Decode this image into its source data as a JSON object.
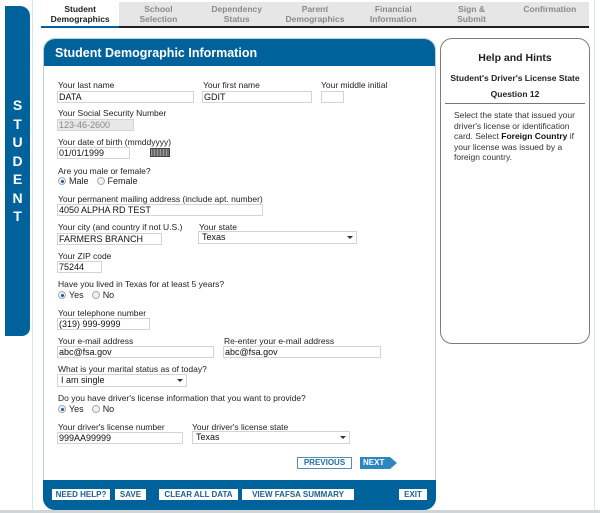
{
  "side_label": "STUDENT",
  "tabs": [
    {
      "line1": "Student",
      "line2": "Demographics",
      "active": true
    },
    {
      "line1": "School",
      "line2": "Selection",
      "active": false
    },
    {
      "line1": "Dependency",
      "line2": "Status",
      "active": false
    },
    {
      "line1": "Parent",
      "line2": "Demographics",
      "active": false
    },
    {
      "line1": "Financial",
      "line2": "Information",
      "active": false
    },
    {
      "line1": "Sign &",
      "line2": "Submit",
      "active": false
    },
    {
      "line1": "Confirmation",
      "line2": "",
      "active": false
    }
  ],
  "form": {
    "title": "Student Demographic Information",
    "last_name": {
      "label": "Your last name",
      "value": "DATA"
    },
    "first_name": {
      "label": "Your first name",
      "value": "GDIT"
    },
    "middle_initial": {
      "label": "Your middle initial",
      "value": ""
    },
    "ssn": {
      "label": "Your Social Security Number",
      "value": "123-46-2600"
    },
    "dob": {
      "label": "Your date of birth (mmddyyyy)",
      "value": "01/01/1999"
    },
    "gender": {
      "label": "Are you male or female?",
      "options": [
        "Male",
        "Female"
      ],
      "selected": "Male"
    },
    "address": {
      "label": "Your permanent mailing address (include apt. number)",
      "value": "4050 ALPHA RD TEST"
    },
    "city": {
      "label": "Your city (and country if not U.S.)",
      "value": "FARMERS BRANCH"
    },
    "state": {
      "label": "Your state",
      "value": "Texas"
    },
    "zip": {
      "label": "Your ZIP code",
      "value": "75244"
    },
    "texas_5yrs": {
      "label": "Have you lived in Texas for at least 5 years?",
      "options": [
        "Yes",
        "No"
      ],
      "selected": "Yes"
    },
    "phone": {
      "label": "Your telephone number",
      "value": "(319) 999-9999"
    },
    "email": {
      "label": "Your e-mail address",
      "value": "abc@fsa.gov"
    },
    "email_confirm": {
      "label": "Re-enter your e-mail address",
      "value": "abc@fsa.gov"
    },
    "marital": {
      "label": "What is your marital status as of today?",
      "value": "I am single"
    },
    "has_license": {
      "label": "Do you have driver's license information that you want to provide?",
      "options": [
        "Yes",
        "No"
      ],
      "selected": "Yes"
    },
    "license_number": {
      "label": "Your driver's license number",
      "value": "999AA99999"
    },
    "license_state": {
      "label": "Your driver's license state",
      "value": "Texas"
    },
    "previous_label": "PREVIOUS",
    "next_label": "NEXT"
  },
  "footer": {
    "need_help": "NEED HELP?",
    "save": "SAVE",
    "clear_all": "CLEAR ALL DATA",
    "view_summary": "VIEW FAFSA SUMMARY",
    "exit": "EXIT"
  },
  "help": {
    "title": "Help and Hints",
    "subtitle": "Student's Driver's License State",
    "question": "Question 12",
    "body_pre": "Select the state that issued your driver's license or identification card. Select ",
    "body_bold": "Foreign Country",
    "body_post": " if your license was issued by a foreign country."
  }
}
